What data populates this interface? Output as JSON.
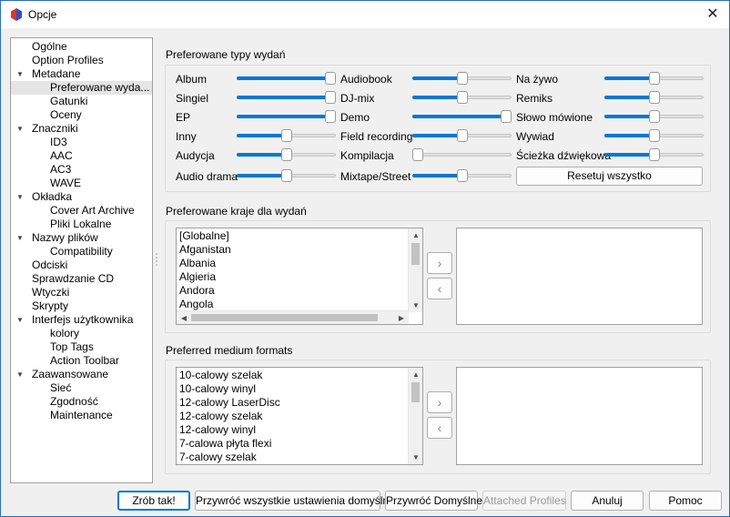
{
  "window": {
    "title": "Opcje",
    "close_icon": "close-icon",
    "app_icon": "picard-logo-icon"
  },
  "sidebar": {
    "items": [
      {
        "label": "Ogólne",
        "level": 0,
        "expandable": false
      },
      {
        "label": "Option Profiles",
        "level": 0,
        "expandable": false
      },
      {
        "label": "Metadane",
        "level": 0,
        "expandable": true
      },
      {
        "label": "Preferowane wyda...",
        "level": 1,
        "expandable": false,
        "selected": true
      },
      {
        "label": "Gatunki",
        "level": 1,
        "expandable": false
      },
      {
        "label": "Oceny",
        "level": 1,
        "expandable": false
      },
      {
        "label": "Znaczniki",
        "level": 0,
        "expandable": true
      },
      {
        "label": "ID3",
        "level": 1,
        "expandable": false
      },
      {
        "label": "AAC",
        "level": 1,
        "expandable": false
      },
      {
        "label": "AC3",
        "level": 1,
        "expandable": false
      },
      {
        "label": "WAVE",
        "level": 1,
        "expandable": false
      },
      {
        "label": "Okładka",
        "level": 0,
        "expandable": true
      },
      {
        "label": "Cover Art Archive",
        "level": 1,
        "expandable": false
      },
      {
        "label": "Pliki Lokalne",
        "level": 1,
        "expandable": false
      },
      {
        "label": "Nazwy plików",
        "level": 0,
        "expandable": true
      },
      {
        "label": "Compatibility",
        "level": 1,
        "expandable": false
      },
      {
        "label": "Odciski",
        "level": 0,
        "expandable": false
      },
      {
        "label": "Sprawdzanie CD",
        "level": 0,
        "expandable": false
      },
      {
        "label": "Wtyczki",
        "level": 0,
        "expandable": false
      },
      {
        "label": "Skrypty",
        "level": 0,
        "expandable": false
      },
      {
        "label": "Interfejs użytkownika",
        "level": 0,
        "expandable": true
      },
      {
        "label": "kolory",
        "level": 1,
        "expandable": false
      },
      {
        "label": "Top Tags",
        "level": 1,
        "expandable": false
      },
      {
        "label": "Action Toolbar",
        "level": 1,
        "expandable": false
      },
      {
        "label": "Zaawansowane",
        "level": 0,
        "expandable": true
      },
      {
        "label": "Sieć",
        "level": 1,
        "expandable": false
      },
      {
        "label": "Zgodność",
        "level": 1,
        "expandable": false
      },
      {
        "label": "Maintenance",
        "level": 1,
        "expandable": false
      }
    ]
  },
  "release_types": {
    "title": "Preferowane typy wydań",
    "sliders": [
      {
        "label": "Album",
        "value": 1.0
      },
      {
        "label": "Audiobook",
        "value": 0.5
      },
      {
        "label": "Na żywo",
        "value": 0.5
      },
      {
        "label": "Singiel",
        "value": 1.0
      },
      {
        "label": "DJ-mix",
        "value": 0.5
      },
      {
        "label": "Remiks",
        "value": 0.5
      },
      {
        "label": "EP",
        "value": 1.0
      },
      {
        "label": "Demo",
        "value": 1.0
      },
      {
        "label": "Słowo mówione",
        "value": 0.5
      },
      {
        "label": "Inny",
        "value": 0.5
      },
      {
        "label": "Field recording",
        "value": 0.5
      },
      {
        "label": "Wywiad",
        "value": 0.5
      },
      {
        "label": "Audycja",
        "value": 0.5
      },
      {
        "label": "Kompilacja",
        "value": 0.0
      },
      {
        "label": "Ścieżka dźwiękowa",
        "value": 0.5
      },
      {
        "label": "Audio drama",
        "value": 0.5
      },
      {
        "label": "Mixtape/Street",
        "value": 0.5
      }
    ],
    "reset_label": "Resetuj wszystko"
  },
  "countries": {
    "title": "Preferowane kraje dla wydań",
    "available": [
      "[Globalne]",
      "Afganistan",
      "Albania",
      "Algieria",
      "Andora",
      "Angola"
    ],
    "add_icon": "chevron-right-icon",
    "remove_icon": "chevron-left-icon"
  },
  "formats": {
    "title": "Preferred medium formats",
    "available": [
      "10-calowy szelak",
      "10-calowy winyl",
      "12-calowy LaserDisc",
      "12-calowy szelak",
      "12-calowy winyl",
      "7-calowa płyta flexi",
      "7-calowy szelak"
    ],
    "add_icon": "chevron-right-icon",
    "remove_icon": "chevron-left-icon"
  },
  "footer": {
    "ok_label": "Zrób tak!",
    "restore_all_label": "Przywróć wszystkie ustawienia domyślne",
    "restore_label": "Przywróć Domyślne",
    "attached_label": "Attached Profiles",
    "cancel_label": "Anuluj",
    "help_label": "Pomoc"
  },
  "colors": {
    "accent": "#0078d4",
    "logo_red": "#e2342b",
    "logo_blue": "#2a53c8"
  }
}
